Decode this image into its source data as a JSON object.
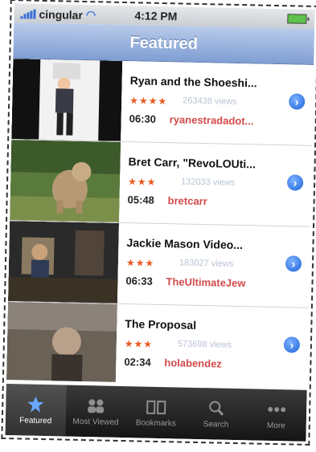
{
  "status": {
    "carrier": "cingular",
    "time": "4:12 PM"
  },
  "navbar": {
    "title": "Featured"
  },
  "videos": [
    {
      "title": "Ryan and the Shoeshi...",
      "stars": "★★★★",
      "views": "263438 views",
      "duration": "06:30",
      "author": "ryanestradadot..."
    },
    {
      "title": "Bret Carr, \"RevoLOUti...",
      "stars": "★★★",
      "views": "132033 views",
      "duration": "05:48",
      "author": "bretcarr"
    },
    {
      "title": "Jackie Mason Video...",
      "stars": "★★★",
      "views": "183027 views",
      "duration": "06:33",
      "author": "TheUltimateJew"
    },
    {
      "title": "The Proposal",
      "stars": "★★★",
      "views": "573698 views",
      "duration": "02:34",
      "author": "holabendez"
    }
  ],
  "tabs": [
    {
      "label": "Featured",
      "icon": "star-icon",
      "active": true
    },
    {
      "label": "Most Viewed",
      "icon": "people-icon",
      "active": false
    },
    {
      "label": "Bookmarks",
      "icon": "book-icon",
      "active": false
    },
    {
      "label": "Search",
      "icon": "search-icon",
      "active": false
    },
    {
      "label": "More",
      "icon": "more-icon",
      "active": false
    }
  ]
}
